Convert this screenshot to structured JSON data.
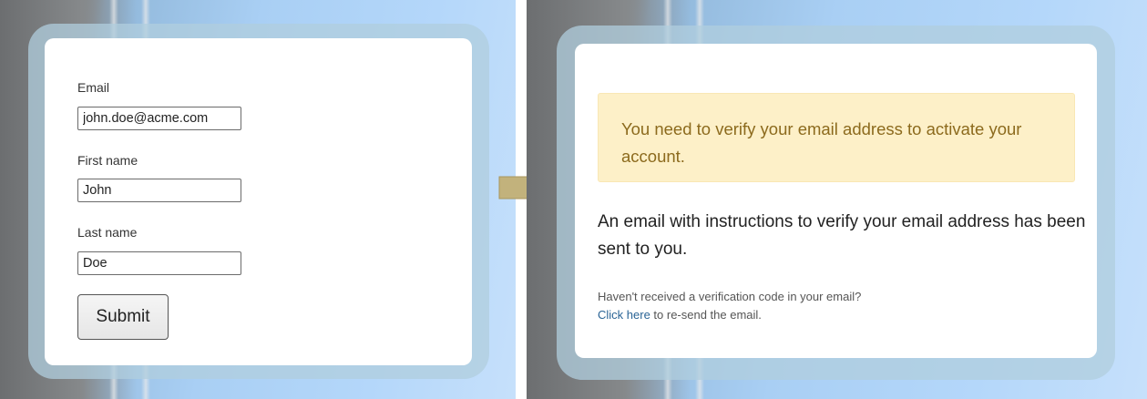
{
  "form": {
    "email_label": "Email",
    "email_value": "john.doe@acme.com",
    "first_name_label": "First name",
    "first_name_value": "John",
    "last_name_label": "Last name",
    "last_name_value": "Doe",
    "submit_label": "Submit"
  },
  "transition": {
    "icon": "arrow-right-icon",
    "color": "#c2b27c"
  },
  "verify": {
    "alert_text": "You need to verify your email address to activate your account.",
    "info_text": "An email with instructions to verify your email address has been sent to you.",
    "hint_question": "Haven't received a verification code in your email?",
    "resend_link": "Click here",
    "resend_suffix": " to re-send the email."
  },
  "colors": {
    "alert_bg": "#fdf0c8",
    "alert_text": "#8c6a1d",
    "link": "#2a6496"
  }
}
